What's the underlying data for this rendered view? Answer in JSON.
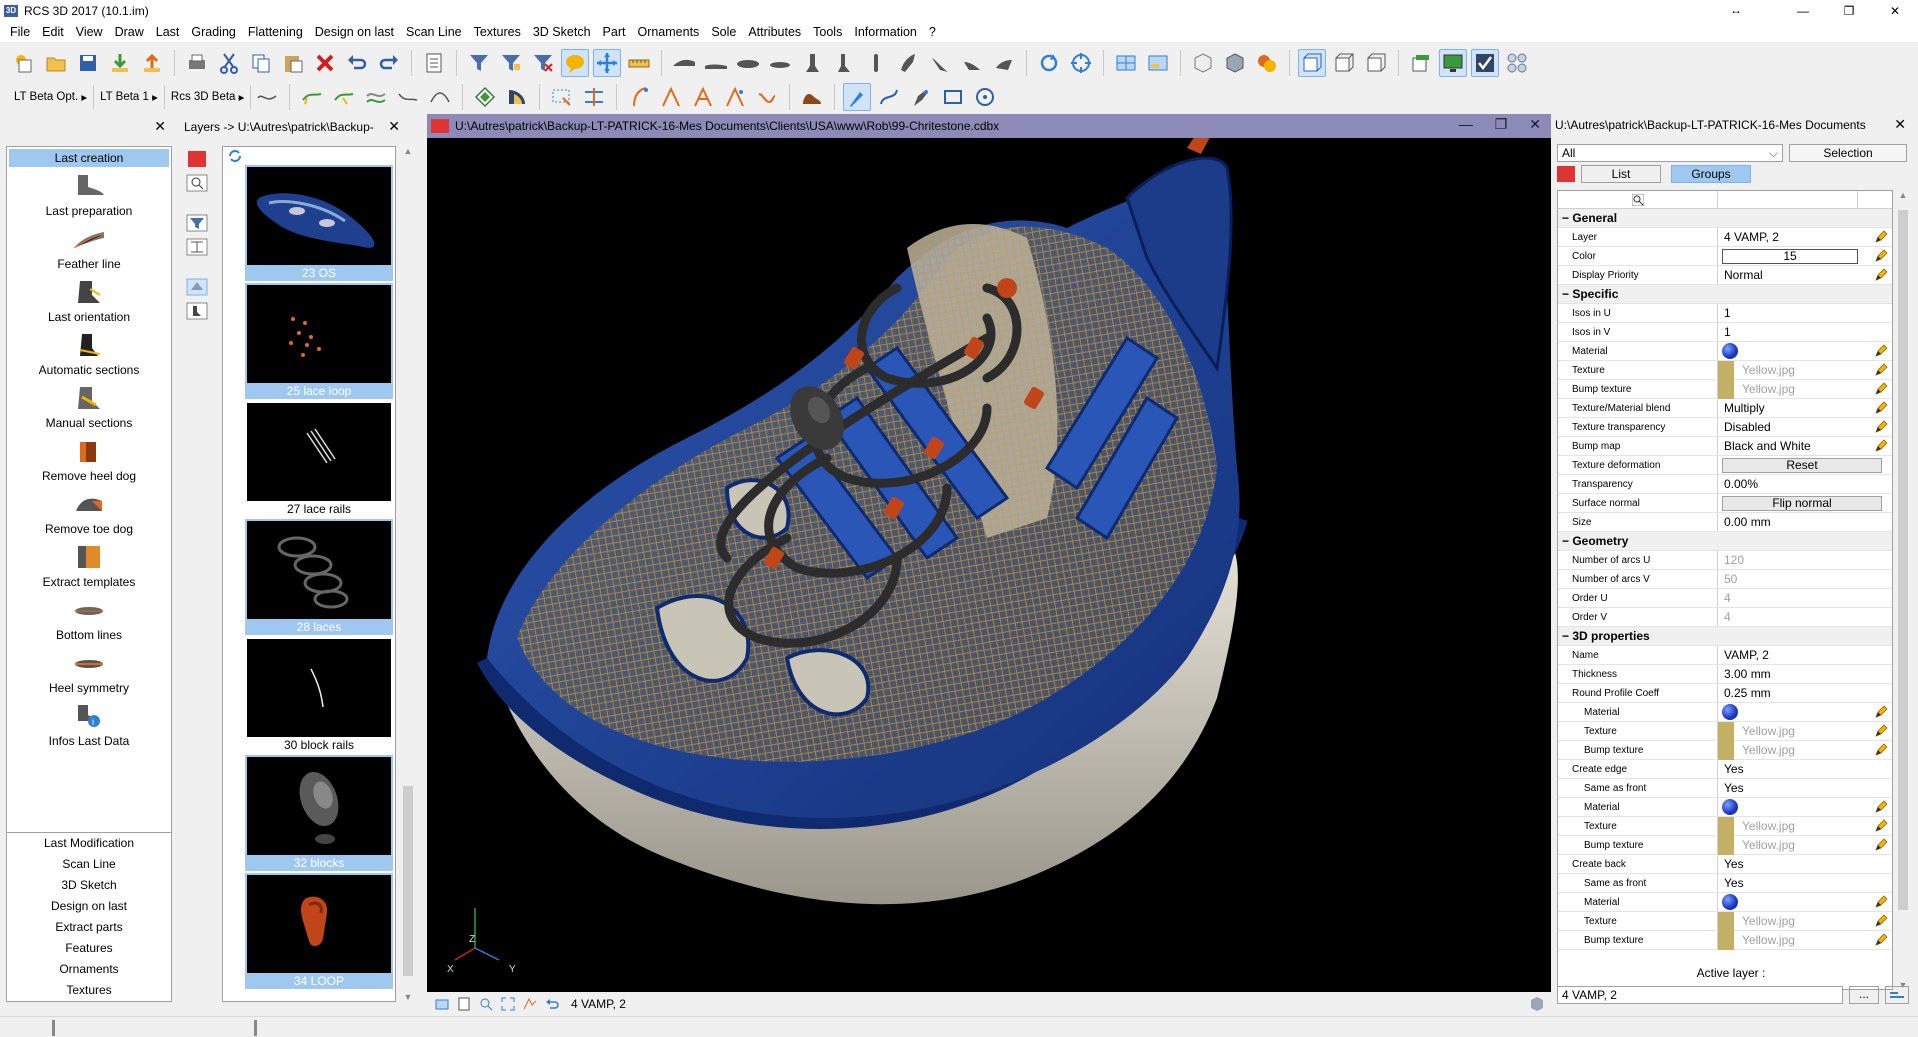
{
  "window": {
    "title": "RCS 3D 2017 (10.1.im)",
    "app_icon": "3D"
  },
  "menu": [
    "File",
    "Edit",
    "View",
    "Draw",
    "Last",
    "Grading",
    "Flattening",
    "Design on last",
    "Scan Line",
    "Textures",
    "3D Sketch",
    "Part",
    "Ornaments",
    "Sole",
    "Attributes",
    "Tools",
    "Information",
    "?"
  ],
  "toolbar2_dropdowns": [
    "LT Beta Opt.",
    "LT Beta 1",
    "Rcs 3D Beta"
  ],
  "left_panel": {
    "header": "Last creation",
    "items": [
      "Last preparation",
      "Feather line",
      "Last orientation",
      "Automatic sections",
      "Manual sections",
      "Remove heel dog",
      "Remove toe dog",
      "Extract templates",
      "Bottom lines",
      "Heel symmetry",
      "Infos Last Data"
    ],
    "categories": [
      "Last Modification",
      "Scan Line",
      "3D Sketch",
      "Design on last",
      "Extract parts",
      "Features",
      "Ornaments",
      "Textures"
    ]
  },
  "layers_panel": {
    "title": "Layers -> U:\\Autres\\patrick\\Backup-",
    "layers": [
      "23  OS",
      "25  lace loop",
      "27  lace rails",
      "28  laces",
      "30  block rails",
      "32  blocks",
      "34  LOOP"
    ],
    "selected": [
      true,
      true,
      false,
      true,
      false,
      true,
      true
    ]
  },
  "viewport": {
    "title": "U:\\Autres\\patrick\\Backup-LT-PATRICK-16-Mes Documents\\Clients\\USA\\www\\Rob\\99-Chritestone.cdbx",
    "axis_x": "X",
    "axis_y": "Y",
    "axis_z": "Z",
    "status_layer": "4  VAMP, 2"
  },
  "properties": {
    "title": "U:\\Autres\\patrick\\Backup-LT-PATRICK-16-Mes Documents",
    "filter": "All",
    "selection_btn": "Selection",
    "tab_list": "List",
    "tab_groups": "Groups",
    "active_layer_label": "Active layer :",
    "active_layer": "4  VAMP, 2",
    "dots": "...",
    "rows": [
      {
        "type": "section",
        "label": "General"
      },
      {
        "label": "Layer",
        "value": "4  VAMP, 2",
        "pencil": true
      },
      {
        "label": "Color",
        "value": "15",
        "kind": "colorbox",
        "pencil": true
      },
      {
        "label": "Display Priority",
        "value": "Normal",
        "pencil": true
      },
      {
        "type": "section",
        "label": "Specific"
      },
      {
        "label": "Isos in U",
        "value": "1"
      },
      {
        "label": "Isos in V",
        "value": "1"
      },
      {
        "label": "Material",
        "kind": "sphere",
        "pencil": true
      },
      {
        "label": "Texture",
        "value": "Yellow.jpg",
        "kind": "swatch",
        "gray": true,
        "pencil": true
      },
      {
        "label": "Bump texture",
        "value": "Yellow.jpg",
        "kind": "swatch",
        "gray": true,
        "pencil": true
      },
      {
        "label": "Texture/Material blend",
        "value": "Multiply",
        "pencil": true
      },
      {
        "label": "Texture transparency",
        "value": "Disabled",
        "pencil": true
      },
      {
        "label": "Bump map",
        "value": "Black and White",
        "pencil": true
      },
      {
        "label": "Texture deformation",
        "value": "Reset",
        "kind": "button"
      },
      {
        "label": "Transparency",
        "value": "0.00%"
      },
      {
        "label": "Surface normal",
        "value": "Flip normal",
        "kind": "button"
      },
      {
        "label": "Size",
        "value": "0.00 mm"
      },
      {
        "type": "section",
        "label": "Geometry"
      },
      {
        "label": "Number of arcs U",
        "value": "120",
        "gray": true
      },
      {
        "label": "Number of arcs V",
        "value": "50",
        "gray": true
      },
      {
        "label": "Order U",
        "value": "4",
        "gray": true
      },
      {
        "label": "Order V",
        "value": "4",
        "gray": true
      },
      {
        "type": "section",
        "label": "3D properties"
      },
      {
        "label": "Name",
        "value": "VAMP, 2"
      },
      {
        "label": "Thickness",
        "value": "3.00 mm"
      },
      {
        "label": "Round Profile Coeff",
        "value": "0.25 mm"
      },
      {
        "label": "Material",
        "kind": "sphere",
        "indent": true,
        "pencil": true
      },
      {
        "label": "Texture",
        "value": "Yellow.jpg",
        "kind": "swatch",
        "gray": true,
        "indent": true,
        "pencil": true
      },
      {
        "label": "Bump texture",
        "value": "Yellow.jpg",
        "kind": "swatch",
        "gray": true,
        "indent": true,
        "pencil": true
      },
      {
        "label": "Create edge",
        "value": "Yes"
      },
      {
        "label": "Same as front",
        "value": "Yes",
        "indent": true
      },
      {
        "label": "Material",
        "kind": "sphere",
        "indent": true,
        "pencil": true
      },
      {
        "label": "Texture",
        "value": "Yellow.jpg",
        "kind": "swatch",
        "gray": true,
        "indent": true,
        "pencil": true
      },
      {
        "label": "Bump texture",
        "value": "Yellow.jpg",
        "kind": "swatch",
        "gray": true,
        "indent": true,
        "pencil": true
      },
      {
        "label": "Create back",
        "value": "Yes"
      },
      {
        "label": "Same as front",
        "value": "Yes",
        "indent": true
      },
      {
        "label": "Material",
        "kind": "sphere",
        "indent": true,
        "pencil": true
      },
      {
        "label": "Texture",
        "value": "Yellow.jpg",
        "kind": "swatch",
        "gray": true,
        "indent": true,
        "pencil": true
      },
      {
        "label": "Bump texture",
        "value": "Yellow.jpg",
        "kind": "swatch",
        "gray": true,
        "indent": true,
        "pencil": true
      }
    ]
  },
  "colors": {
    "selection": "#9fc8f0",
    "viewport_title": "#8d8ab8",
    "shoe_blue": "#1f3f8f",
    "accent_red": "#e03434"
  }
}
